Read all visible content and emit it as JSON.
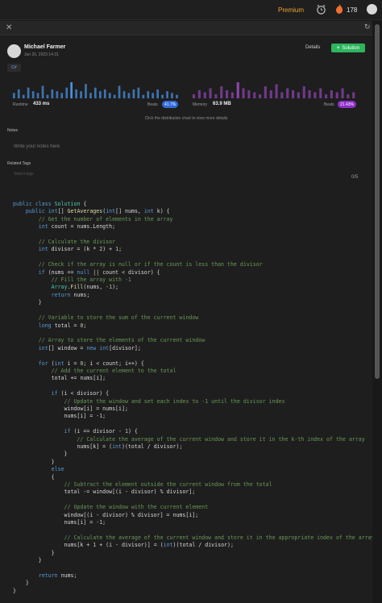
{
  "topbar": {
    "premium_label": "Premium",
    "streak_count": "178"
  },
  "submission": {
    "user_name": "Michael Farmer",
    "date": "Jun 20, 2023 14:31",
    "details_label": "Details",
    "solution_label": "Solution",
    "language": "C#"
  },
  "runtime": {
    "label": "Runtime",
    "value": "433 ms",
    "beats_label": "Beats",
    "beats_value": "41.7%",
    "distribution": [
      3,
      5,
      2,
      6,
      4,
      3,
      7,
      2,
      5,
      4,
      3,
      6,
      9,
      5,
      4,
      8,
      3,
      6,
      4,
      5,
      3,
      2,
      7,
      4,
      3,
      5,
      6,
      2,
      4,
      3,
      5,
      2,
      4,
      3,
      2
    ]
  },
  "memory": {
    "label": "Memory",
    "value": "63.9 MB",
    "beats_label": "Beats",
    "beats_value": "21.43%",
    "distribution": [
      2,
      4,
      3,
      5,
      2,
      6,
      4,
      3,
      8,
      5,
      4,
      3,
      2,
      6,
      4,
      7,
      3,
      5,
      4,
      3,
      6,
      4,
      3,
      5,
      2,
      4,
      3,
      5,
      2,
      3
    ]
  },
  "hint": "Click the distribution chart to view more details",
  "notes": {
    "label": "Notes",
    "placeholder": "Write your notes here"
  },
  "tags": {
    "label": "Related Tags",
    "placeholder": "Select tags",
    "count": "0/5"
  },
  "colors": {
    "runtime_bar": "#4a90e2",
    "memory_bar": "#8e44ad",
    "solution_button": "#2db55d",
    "premium": "#f0a22e"
  },
  "code_lines": [
    "public class Solution {",
    "    public int[] GetAverages(int[] nums, int k) {",
    "        // Get the number of elements in the array",
    "        int count = nums.Length;",
    "",
    "        // Calculate the divisor",
    "        int divisor = (k * 2) + 1;",
    "",
    "        // Check if the array is null or if the count is less than the divisor",
    "        if (nums == null || count < divisor) {",
    "            // Fill the array with -1",
    "            Array.Fill(nums, -1);",
    "            return nums;",
    "        }",
    "",
    "        // Variable to store the sum of the current window",
    "        long total = 0;",
    "",
    "        // Array to store the elements of the current window",
    "        int[] window = new int[divisor];",
    "",
    "        for (int i = 0; i < count; i++) {",
    "            // Add the current element to the total",
    "            total += nums[i];",
    "",
    "            if (i < divisor) {",
    "                // Update the window and set each index to -1 until the divisor index",
    "                window[i] = nums[i];",
    "                nums[i] = -1;",
    "",
    "                if (i == divisor - 1) {",
    "                    // Calculate the average of the current window and store it in the k-th index of the array",
    "                    nums[k] = (int)(total / divisor);",
    "                }",
    "            }",
    "            else",
    "            {",
    "                // Subtract the element outside the current window from the total",
    "                total -= window[(i - divisor) % divisor];",
    "",
    "                // Update the window with the current element",
    "                window[(i - divisor) % divisor] = nums[i];",
    "                nums[i] = -1;",
    "",
    "                // Calculate the average of the current window and store it in the appropriate index of the array",
    "                nums[k + 1 + (i - divisor)] = (int)(total / divisor);",
    "            }",
    "        }",
    "",
    "        return nums;",
    "    }",
    "}"
  ]
}
